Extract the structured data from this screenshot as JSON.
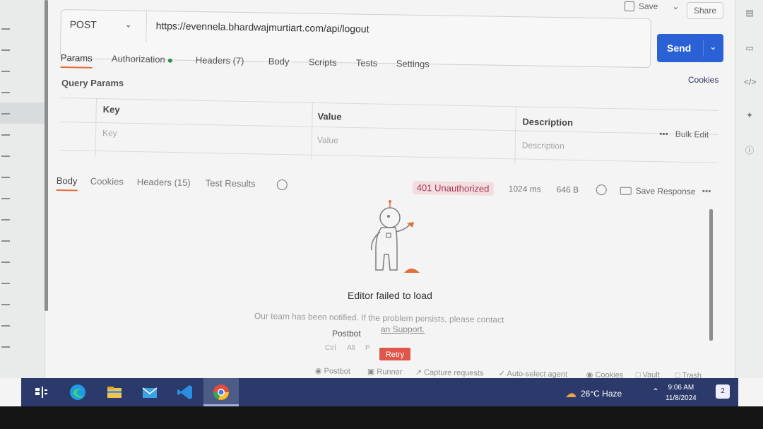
{
  "header": {
    "save_label": "Save",
    "share_label": "Share"
  },
  "request": {
    "method": "POST",
    "url": "https://evennela.bhardwajmurtiart.com/api/logout",
    "send_label": "Send",
    "tabs": [
      {
        "label": "Params",
        "active": true
      },
      {
        "label": "Authorization",
        "dot": true
      },
      {
        "label": "Headers (7)"
      },
      {
        "label": "Body"
      },
      {
        "label": "Scripts"
      },
      {
        "label": "Tests"
      },
      {
        "label": "Settings"
      }
    ],
    "cookies_label": "Cookies",
    "query_params_label": "Query Params",
    "table": {
      "headers": [
        "Key",
        "Value",
        "Description"
      ],
      "placeholders": [
        "Key",
        "Value",
        "Description"
      ],
      "bulk_edit_label": "Bulk Edit"
    }
  },
  "response": {
    "tabs": [
      "Body",
      "Cookies",
      "Headers (15)",
      "Test Results"
    ],
    "status": "401 Unauthorized",
    "time": "1024 ms",
    "size": "646 B",
    "save_response_label": "Save Response",
    "more_label": "•••",
    "error_title": "Editor failed to load",
    "error_message": "Our team has been notified. If the problem persists, please contact",
    "support_link": "an Support.",
    "postbot_label": "Postbot",
    "shortcut_keys": [
      "Ctrl",
      "Alt",
      "P"
    ],
    "retry_label": "Retry"
  },
  "statusbar": [
    "Postbot",
    "Runner",
    "Capture requests",
    "Auto-select agent",
    "Cookies",
    "Vault",
    "Trash"
  ],
  "taskbar": {
    "weather": "26°C  Haze",
    "time": "9:06 AM",
    "date": "11/8/2024",
    "notif_count": "2"
  },
  "colors": {
    "accent": "#e46f3e",
    "send": "#2a62d6",
    "status_error": "#a5384f",
    "taskbar": "#2b3a6a"
  }
}
